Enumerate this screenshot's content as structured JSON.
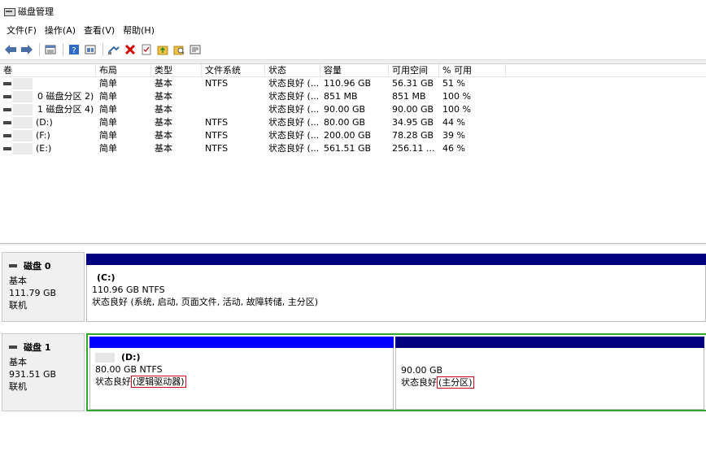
{
  "window": {
    "title": "磁盘管理"
  },
  "menu": [
    {
      "label": "文件(F)"
    },
    {
      "label": "操作(A)"
    },
    {
      "label": "查看(V)"
    },
    {
      "label": "帮助(H)"
    }
  ],
  "toolbar": {
    "icons": [
      "back-icon",
      "forward-icon",
      "disk-list-icon",
      "help-icon",
      "graphical-view-icon",
      "connect-icon",
      "delete-icon",
      "check-icon",
      "folder-up-icon",
      "search-folder-icon",
      "properties-icon"
    ]
  },
  "volume_table": {
    "headers": [
      "卷",
      "布局",
      "类型",
      "文件系统",
      "状态",
      "容量",
      "可用空间",
      "% 可用"
    ],
    "rows": [
      {
        "volume": "",
        "layout": "简单",
        "type": "基本",
        "fs": "NTFS",
        "status": "状态良好 (...",
        "capacity": "110.96 GB",
        "free": "56.31 GB",
        "pct": "51 %"
      },
      {
        "volume": "0 磁盘分区 2)",
        "layout": "简单",
        "type": "基本",
        "fs": "",
        "status": "状态良好 (...",
        "capacity": "851 MB",
        "free": "851 MB",
        "pct": "100 %"
      },
      {
        "volume": "1 磁盘分区 4)",
        "layout": "简单",
        "type": "基本",
        "fs": "",
        "status": "状态良好 (...",
        "capacity": "90.00 GB",
        "free": "90.00 GB",
        "pct": "100 %"
      },
      {
        "volume": "(D:)",
        "layout": "简单",
        "type": "基本",
        "fs": "NTFS",
        "status": "状态良好 (...",
        "capacity": "80.00 GB",
        "free": "34.95 GB",
        "pct": "44 %"
      },
      {
        "volume": "(F:)",
        "layout": "简单",
        "type": "基本",
        "fs": "NTFS",
        "status": "状态良好 (...",
        "capacity": "200.00 GB",
        "free": "78.28 GB",
        "pct": "39 %"
      },
      {
        "volume": "(E:)",
        "layout": "简单",
        "type": "基本",
        "fs": "NTFS",
        "status": "状态良好 (...",
        "capacity": "561.51 GB",
        "free": "256.11 ...",
        "pct": "46 %"
      }
    ]
  },
  "disks": [
    {
      "name": "磁盘 0",
      "type": "基本",
      "size": "111.79 GB",
      "state": "联机",
      "partitions": [
        {
          "title": "(C:)",
          "size_fs": "110.96 GB NTFS",
          "status_prefix": "状态良好 (系统, 启动, 页面文件, 活动, 故障转储, 主分区)",
          "status_boxed": "",
          "bar_color": "#000080"
        }
      ]
    },
    {
      "name": "磁盘 1",
      "type": "基本",
      "size": "931.51 GB",
      "state": "联机",
      "partitions": [
        {
          "title": "(D:)",
          "size_fs": "80.00 GB NTFS",
          "status_prefix": "状态良好",
          "status_boxed": "(逻辑驱动器)",
          "bar_color": "#0000ff"
        },
        {
          "title": "",
          "size_fs": "90.00 GB",
          "status_prefix": "状态良好",
          "status_boxed": "(主分区)",
          "bar_color": "#000080"
        }
      ]
    }
  ],
  "colors": {
    "primary_bar": "#000080",
    "logical_bar": "#0000ff",
    "extended_border": "#2ea82e",
    "highlight_box": "#d0021b"
  }
}
